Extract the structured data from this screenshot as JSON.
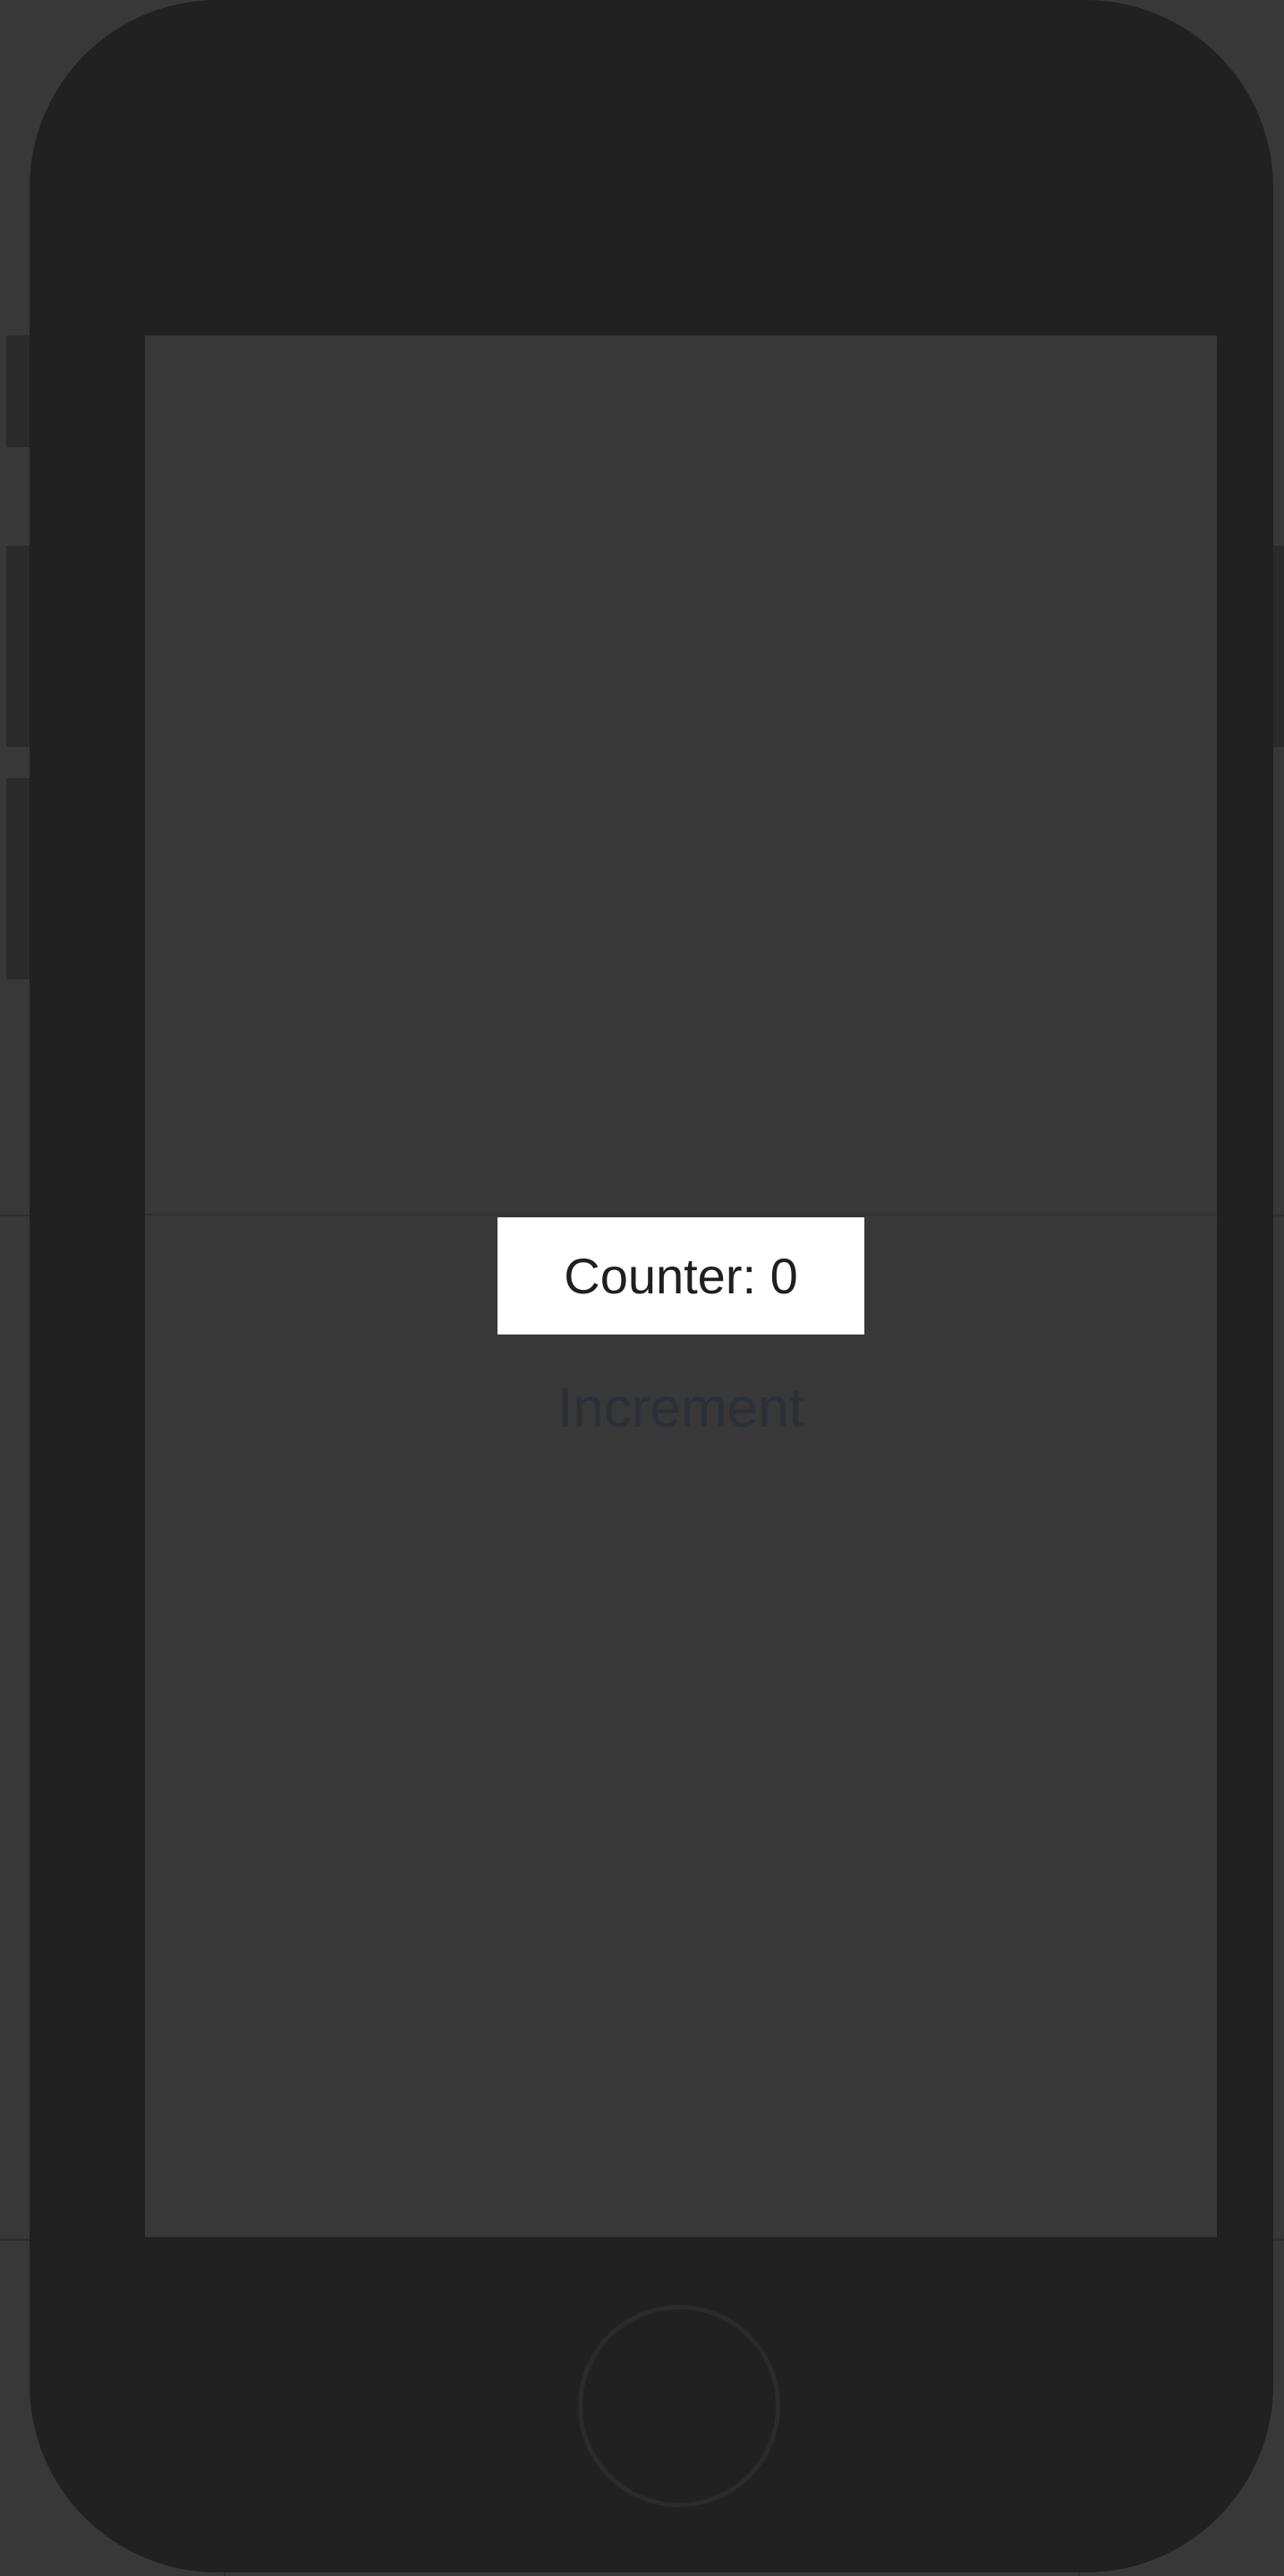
{
  "app": {
    "counter_label": "Counter: 0",
    "increment_label": "Increment"
  },
  "colors": {
    "background": "#383838",
    "device_body": "#212121",
    "screen": "#383838",
    "label_background": "#ffffff",
    "label_text": "#1f1f1f",
    "button_text": "#2b2f36"
  },
  "icons": {
    "home_button": "home-button-icon"
  }
}
